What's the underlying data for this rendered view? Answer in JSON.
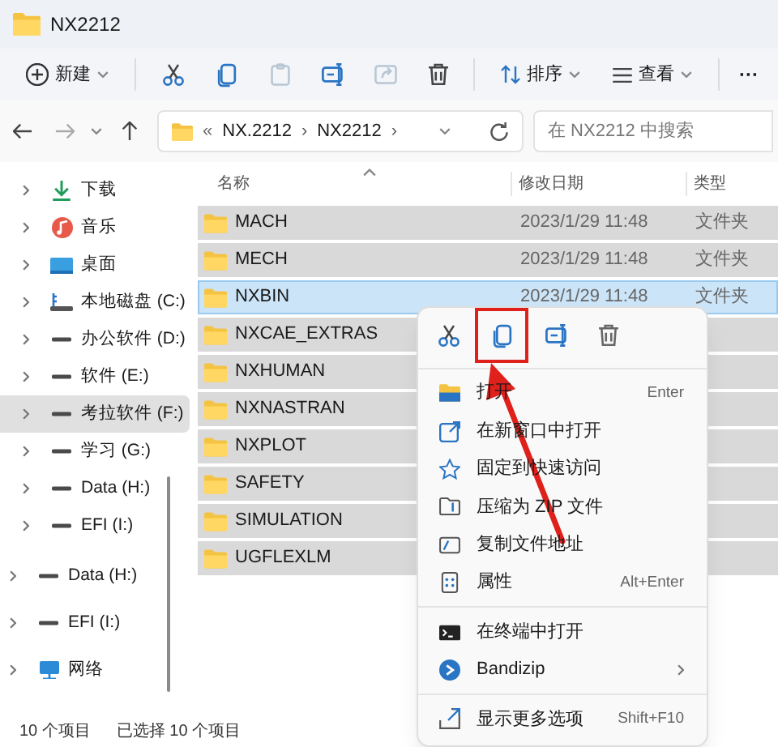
{
  "window": {
    "title": "NX2212"
  },
  "toolbar": {
    "new_label": "新建",
    "buttons": [
      {
        "kind": "cut",
        "disabled": false
      },
      {
        "kind": "copy",
        "disabled": false
      },
      {
        "kind": "paste",
        "disabled": true
      },
      {
        "kind": "rename",
        "disabled": false
      },
      {
        "kind": "share",
        "disabled": true
      },
      {
        "kind": "delete",
        "disabled": false
      }
    ],
    "sort_label": "排序",
    "view_label": "查看",
    "more": "···"
  },
  "address_bar": {
    "overflow": "«",
    "path": [
      "NX.2212",
      "NX2212"
    ],
    "separator": "›",
    "forward_disabled": true,
    "search_placeholder": "在 NX2212 中搜索"
  },
  "sidebar": {
    "groups": [
      {
        "kind": "nested",
        "items": [
          {
            "kind": "download",
            "label": "下载",
            "selected": false
          },
          {
            "kind": "music",
            "label": "音乐",
            "selected": false
          },
          {
            "kind": "desktop",
            "label": "桌面",
            "selected": false
          },
          {
            "kind": "system_drive",
            "label": "本地磁盘 (C:)",
            "selected": false
          },
          {
            "kind": "drive",
            "label": "办公软件 (D:)",
            "selected": false
          },
          {
            "kind": "drive",
            "label": "软件 (E:)",
            "selected": false
          },
          {
            "kind": "drive",
            "label": "考拉软件 (F:)",
            "selected": true
          },
          {
            "kind": "drive",
            "label": "学习 (G:)",
            "selected": false
          },
          {
            "kind": "drive",
            "label": "Data (H:)",
            "selected": false
          },
          {
            "kind": "drive",
            "label": "EFI (I:)",
            "selected": false
          }
        ]
      },
      {
        "kind": "root",
        "items": [
          {
            "kind": "drive",
            "label": "Data (H:)",
            "selected": false
          },
          {
            "kind": "drive",
            "label": "EFI (I:)",
            "selected": false
          },
          {
            "kind": "network",
            "label": "网络",
            "selected": false
          }
        ]
      }
    ]
  },
  "table": {
    "columns": [
      "名称",
      "修改日期",
      "类型"
    ],
    "rows": [
      {
        "name": "MACH",
        "date": "2023/1/29 11:48",
        "type": "文件夹",
        "selected": true,
        "focused": false
      },
      {
        "name": "MECH",
        "date": "2023/1/29 11:48",
        "type": "文件夹",
        "selected": true,
        "focused": false
      },
      {
        "name": "NXBIN",
        "date": "2023/1/29 11:48",
        "type": "文件夹",
        "selected": true,
        "focused": true
      },
      {
        "name": "NXCAE_EXTRAS",
        "selected": true,
        "focused": false
      },
      {
        "name": "NXHUMAN",
        "selected": true,
        "focused": false
      },
      {
        "name": "NXNASTRAN",
        "selected": true,
        "focused": false
      },
      {
        "name": "NXPLOT",
        "selected": true,
        "focused": false
      },
      {
        "name": "SAFETY",
        "selected": true,
        "focused": false
      },
      {
        "name": "SIMULATION",
        "selected": true,
        "focused": false
      },
      {
        "name": "UGFLEXLM",
        "selected": true,
        "focused": false
      }
    ]
  },
  "status_bar": {
    "count": "10 个项目",
    "selection": "已选择 10 个项目"
  },
  "context_menu": {
    "actions": [
      {
        "kind": "cut",
        "highlighted": false
      },
      {
        "kind": "copy",
        "highlighted": true
      },
      {
        "kind": "rename",
        "highlighted": false
      },
      {
        "kind": "delete",
        "highlighted": false
      }
    ],
    "sections": [
      [
        {
          "kind": "open",
          "label": "打开",
          "shortcut": "Enter"
        },
        {
          "kind": "new_window",
          "label": "在新窗口中打开"
        },
        {
          "kind": "pin",
          "label": "固定到快速访问"
        },
        {
          "kind": "zip",
          "label": "压缩为 ZIP 文件"
        },
        {
          "kind": "copy_path",
          "label": "复制文件地址"
        },
        {
          "kind": "properties",
          "label": "属性",
          "shortcut": "Alt+Enter"
        }
      ],
      [
        {
          "kind": "terminal",
          "label": "在终端中打开"
        },
        {
          "kind": "bandizip",
          "label": "Bandizip",
          "submenu": true
        }
      ],
      [
        {
          "kind": "more",
          "label": "显示更多选项",
          "shortcut": "Shift+F10"
        }
      ]
    ]
  }
}
